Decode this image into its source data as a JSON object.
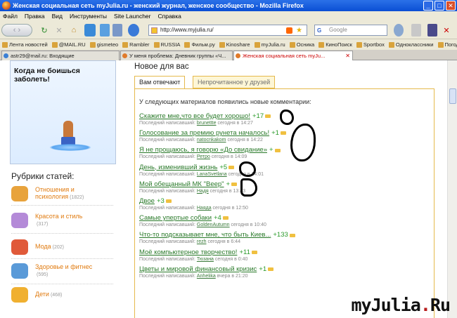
{
  "window": {
    "title": "Женская социальная сеть myJulia.ru - женский журнал, женское сообщество - Mozilla Firefox"
  },
  "menu": [
    "Файл",
    "Правка",
    "Вид",
    "Инструменты",
    "Site Launcher",
    "Справка"
  ],
  "nav": {
    "url": "http://www.myjulia.ru/",
    "search_placeholder": "Google"
  },
  "bookmarks": [
    "Лента новостей",
    "@MAIL.RU",
    "gismeteo",
    "Rambler",
    "RUSSIA",
    "Фильм.ру",
    "Kinoshare",
    "myJulia.ru",
    "Осника",
    "КиноПоиск",
    "Sportbox",
    "Одноклассники",
    "Погода"
  ],
  "tabs": [
    {
      "label": "astr29@mail.ru: Входящие"
    },
    {
      "label": "У меня проблема: Дневник группы «Ч..."
    },
    {
      "label": "Женская социальная сеть myJu..."
    }
  ],
  "sidebar": {
    "banner_title": "Когда не боишься заболеть!",
    "rubrics_title": "Рубрики статей:",
    "rubrics": [
      {
        "label": "Отношения и психология",
        "count": "(1822)",
        "color": "#e8a33c"
      },
      {
        "label": "Красота и стиль",
        "count": "(317)",
        "color": "#b48ad8"
      },
      {
        "label": "Мода",
        "count": "(202)",
        "color": "#e05a3a"
      },
      {
        "label": "Здоровье и фитнес",
        "count": "(595)",
        "color": "#5a9ad8"
      },
      {
        "label": "Дети",
        "count": "(468)",
        "color": "#f0b030"
      }
    ]
  },
  "main": {
    "heading": "Новое для вас",
    "tab_active": "Вам отвечают",
    "tab_inactive": "Непрочитанное у друзей",
    "intro": "У следующих материалов появились новые комментарии:",
    "meta_prefix": "Последний написавший:",
    "entries": [
      {
        "title": "Скажите мне,что все будет хорошо!",
        "count": "+17",
        "user": "brunettte",
        "time": "сегодня в 14:27"
      },
      {
        "title": "Голосование за премию рунета началось!",
        "count": "+1",
        "user": "natocnkakom",
        "time": "сегодня в 14:22"
      },
      {
        "title": "Я не прощаюсь, я говорю «До свидание»",
        "count": "+",
        "user": "Ретро",
        "time": "сегодня в 14:09"
      },
      {
        "title": "День, изменивший жизнь",
        "count": "+5",
        "user": "LanaSvetlana",
        "time": "сегодня в 14:01"
      },
      {
        "title": "Мой обещанный МК \"Веер\"",
        "count": "+",
        "user": "Надя",
        "time": "сегодня в 13:43"
      },
      {
        "title": "Двое",
        "count": "+3",
        "user": "Наяда",
        "time": "сегодня в 12:50"
      },
      {
        "title": "Самые упертые собаки",
        "count": "+4",
        "user": "GoldenAutumn",
        "time": "сегодня в 10:40"
      },
      {
        "title": "Что-то подсказывает мне, что быть Киев...",
        "count": "+133",
        "user": "rezh",
        "time": "сегодня в 6:44"
      },
      {
        "title": "Моё компьютерное творчество!",
        "count": "+11",
        "user": "Тюзана",
        "time": "сегодня в 0:40"
      },
      {
        "title": "Цветы и мировой финансовый кризис",
        "count": "+1",
        "user": "Anhelika",
        "time": "вчера в 21:20"
      }
    ]
  },
  "watermark": {
    "part1": "myJulia",
    "dot": ".",
    "part2": "Ru"
  }
}
